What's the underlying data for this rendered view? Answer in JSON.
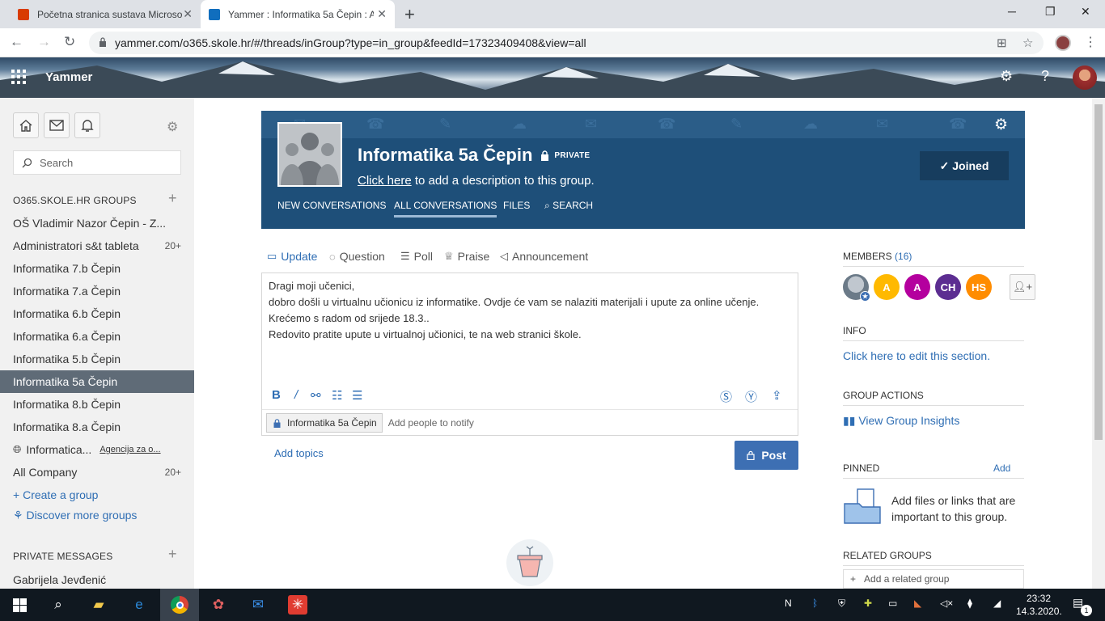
{
  "browser": {
    "tabs": [
      {
        "title": "Početna stranica sustava Microso",
        "favicon_color": "#d83b01"
      },
      {
        "title": "Yammer : Informatika 5a Čepin : A",
        "favicon_color": "#106ebe"
      }
    ],
    "url": "yammer.com/o365.skole.hr/#/threads/inGroup?type=in_group&feedId=17323409408&view=all"
  },
  "header": {
    "brand": "Yammer"
  },
  "sidebar": {
    "search_placeholder": "Search",
    "groups_title": "O365.SKOLE.HR GROUPS",
    "groups": [
      {
        "label": "OŠ Vladimir Nazor Čepin - Z...",
        "count": ""
      },
      {
        "label": "Administratori s&t tableta",
        "count": "20+"
      },
      {
        "label": "Informatika 7.b Čepin",
        "count": ""
      },
      {
        "label": "Informatika 7.a Čepin",
        "count": ""
      },
      {
        "label": "Informatika 6.b Čepin",
        "count": ""
      },
      {
        "label": "Informatika 6.a Čepin",
        "count": ""
      },
      {
        "label": "Informatika 5.b Čepin",
        "count": ""
      },
      {
        "label": "Informatika 5a Čepin",
        "count": ""
      },
      {
        "label": "Informatika 8.b Čepin",
        "count": ""
      },
      {
        "label": "Informatika 8.a Čepin",
        "count": ""
      }
    ],
    "external_group": {
      "label": "Informatica...",
      "sub": "Agencija za o..."
    },
    "all_company": {
      "label": "All Company",
      "count": "20+"
    },
    "create_group": "Create a group",
    "discover_groups": "Discover more groups",
    "private_title": "PRIVATE MESSAGES",
    "private_first": "Gabrijela Jevđenić"
  },
  "group": {
    "name": "Informatika 5a Čepin",
    "privacy": "PRIVATE",
    "desc_link": "Click here",
    "desc_rest": " to add a description to this group.",
    "tabs": [
      "NEW CONVERSATIONS",
      "ALL CONVERSATIONS",
      "FILES",
      "SEARCH"
    ],
    "joined_label": "Joined"
  },
  "publisher": {
    "types": [
      "Update",
      "Question",
      "Poll",
      "Praise",
      "Announcement"
    ],
    "lines": [
      "Dragi moji učenici,",
      "dobro došli u virtualnu učionicu iz informatike. Ovdje će vam se nalaziti materijali i upute za online učenje. Krećemo  s radom od srijede 18.3..",
      "Redovito pratite upute u virtualnoj učionici, te na web stranici škole."
    ],
    "group_chip": "Informatika 5a Čepin",
    "notify_placeholder": "Add people to notify",
    "add_topics": "Add topics",
    "post_label": "Post"
  },
  "right": {
    "members_title": "MEMBERS",
    "members_count": "(16)",
    "members": [
      {
        "initials": "A",
        "color": "#ffb900"
      },
      {
        "initials": "A",
        "color": "#b4009e"
      },
      {
        "initials": "CH",
        "color": "#5c2d91"
      },
      {
        "initials": "HS",
        "color": "#ff8c00"
      }
    ],
    "info_title": "INFO",
    "info_link": "Click here to edit this section.",
    "actions_title": "GROUP ACTIONS",
    "insights_link": "View Group Insights",
    "pinned_title": "PINNED",
    "pinned_add": "Add",
    "pinned_text": "Add files or links that are important to this group.",
    "related_title": "RELATED GROUPS",
    "related_add": "Add a related group"
  },
  "taskbar": {
    "time": "23:32",
    "date": "14.3.2020.",
    "notification_count": "1"
  }
}
